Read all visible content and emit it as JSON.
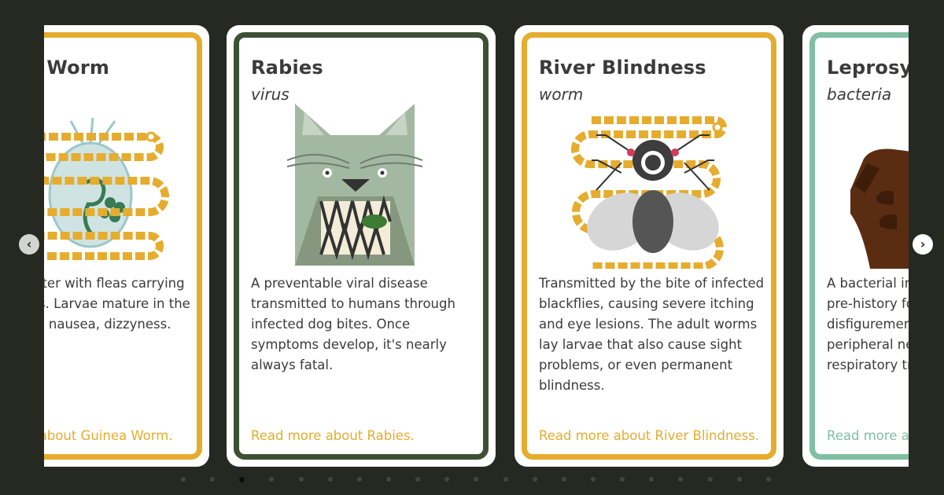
{
  "carousel": {
    "prev_icon": "chevron-left-icon",
    "next_icon": "chevron-right-icon",
    "prev_glyph": "‹",
    "next_glyph": "›",
    "dot_count": 21,
    "active_dot": 2,
    "cards": [
      {
        "title": "Guinea Worm",
        "type": "",
        "description": "Drinking water with fleas carrying roundworms. Larvae mature in the gut, causing nausea, dizzyness.",
        "link": "Read more about Guinea Worm.",
        "accent": "#e5ac2e",
        "illustration": "worm-icon"
      },
      {
        "title": "Rabies",
        "type": "virus",
        "description": "A preventable viral disease transmitted to humans through infected dog bites. Once symptoms develop, it's nearly always fatal.",
        "link": "Read more about Rabies.",
        "accent": "#3c5133",
        "illustration": "rabid-dog-icon"
      },
      {
        "title": "River Blindness",
        "type": "worm",
        "description": "Transmitted by the bite of infected blackflies, causing severe itching and eye lesions. The adult worms lay larvae that also cause sight problems, or even permanent blindness.",
        "link": "Read more about River Blindness.",
        "accent": "#e5ac2e",
        "illustration": "blackfly-icon"
      },
      {
        "title": "Leprosy",
        "type": "bacteria",
        "description": "A bacterial infection known since pre-history for causing disfigurement of the skin. It affects peripheral nerves and the respiratory tract.",
        "link": "Read more about Leprosy.",
        "accent": "#7fbfa2",
        "illustration": "hand-icon"
      }
    ]
  },
  "colors": {
    "background": "#262822",
    "gold": "#e5ac2e",
    "dark_green": "#3c5133",
    "mint": "#7fbfa2",
    "text": "#3b3b3b"
  }
}
